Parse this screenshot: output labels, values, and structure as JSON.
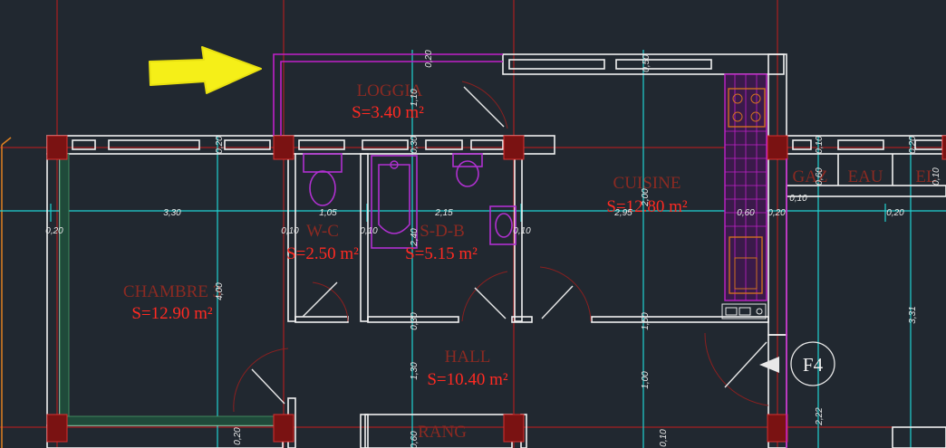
{
  "rooms": {
    "loggia": {
      "name": "LOGGIA",
      "area": "S=3.40 m²"
    },
    "wc": {
      "name": "W-C",
      "area": "S=2.50 m²"
    },
    "sdb": {
      "name": "S-D-B",
      "area": "S=5.15 m²"
    },
    "cuisine": {
      "name": "CUISINE",
      "area": "S=12.80 m²"
    },
    "chambre3": {
      "name": "CHAMBRE 3",
      "area": "S=12.90 m²"
    },
    "hall": {
      "name": "HALL",
      "area": "S=10.40 m²"
    },
    "rang": {
      "name": "RANG"
    },
    "gaz": {
      "name": "GAZ"
    },
    "eau": {
      "name": "EAU"
    },
    "el": {
      "name": "EL"
    }
  },
  "apartment_tag": "F4",
  "dimensions": {
    "d330": "3,30",
    "d105": "1,05",
    "d215": "2,15",
    "d295": "2,95",
    "d060": "0,60",
    "d020a": "0,20",
    "d010a": "0,10",
    "d010b": "0,10",
    "d010c": "0,10",
    "d020b": "0,20",
    "d010d": "0,10",
    "d020c": "0,20",
    "v020a": "0,20",
    "v110": "1,10",
    "v050": "0,50",
    "v020b": "0,20",
    "v030a": "0,30",
    "v010": "0,10",
    "v400": "4,00",
    "v240": "2,40",
    "v200": "2,00",
    "v030b": "0,30",
    "v150": "1,50",
    "v130": "1,30",
    "v060a": "0,60",
    "v060b": "0,60",
    "v100": "1,00",
    "v010c": "0,10",
    "v020c": "0,20",
    "v331": "3,31",
    "v222": "2,22",
    "v020d": "0,20",
    "v010e": "0,10"
  }
}
